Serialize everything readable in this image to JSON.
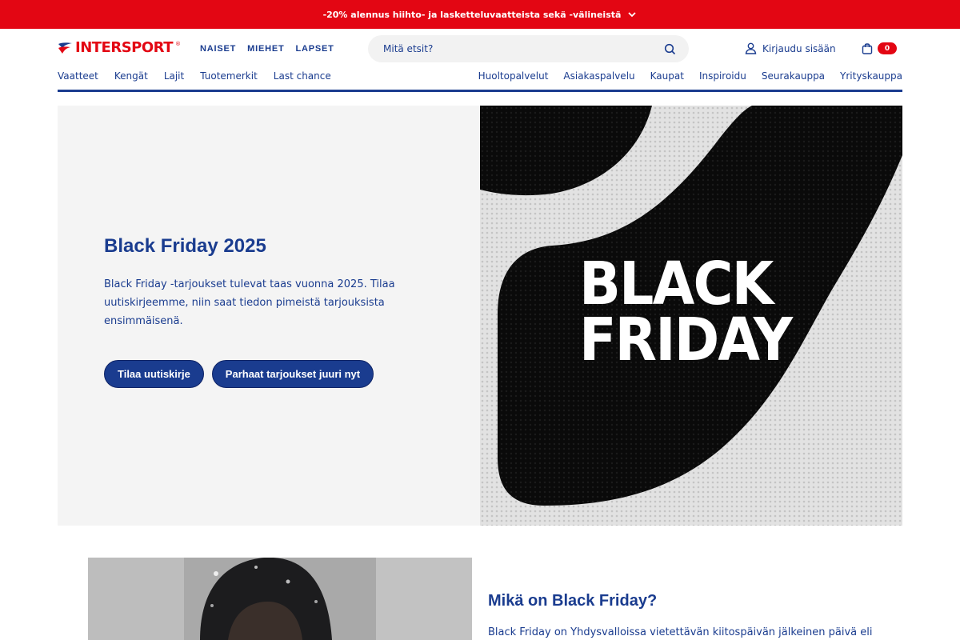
{
  "promo": {
    "text": "-20% alennus hiihto- ja lasketteluvaatteista sekä -välineistä",
    "icon": "chevron-down-icon"
  },
  "header": {
    "logo": "INTERSPORT",
    "gender_nav": [
      "NAISET",
      "MIEHET",
      "LAPSET"
    ],
    "search": {
      "placeholder": "Mitä etsit?",
      "icon": "search-icon"
    },
    "login": {
      "label": "Kirjaudu sisään",
      "icon": "user-icon"
    },
    "cart": {
      "count": "0",
      "icon": "shopping-bag-icon"
    }
  },
  "category_nav": [
    "Vaatteet",
    "Kengät",
    "Lajit",
    "Tuotemerkit",
    "Last chance"
  ],
  "service_nav": [
    "Huoltopalvelut",
    "Asiakaspalvelu",
    "Kaupat",
    "Inspiroidu",
    "Seurakauppa",
    "Yrityskauppa"
  ],
  "hero": {
    "title": "Black Friday 2025",
    "text": "Black Friday -tarjoukset tulevat taas vuonna 2025. Tilaa uutiskirjeemme, niin saat tiedon pimeistä tarjouksista ensimmäisenä.",
    "button_primary": "Tilaa uutiskirje",
    "button_secondary": "Parhaat tarjoukset juuri nyt",
    "image_line1": "BLACK",
    "image_line2": "FRIDAY"
  },
  "article": {
    "title": "Mikä on Black Friday?",
    "text": "Black Friday on Yhdysvalloissa vietettävän kiitospäivän jälkeinen päivä eli"
  },
  "colors": {
    "brand_red": "#e30613",
    "brand_blue": "#1a3c8f",
    "hero_bg": "#f4f4f4"
  }
}
